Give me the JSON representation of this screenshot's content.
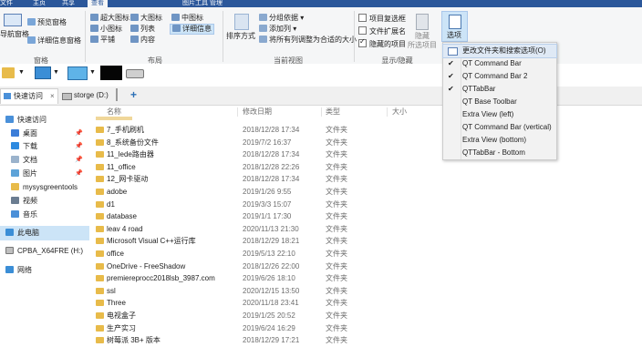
{
  "ribbon_tabs": [
    "文件",
    "主页",
    "共享",
    "查看",
    "图片工具 管理"
  ],
  "ribbon": {
    "pane_group": {
      "nav_pane": "导航窗格",
      "preview_pane": "预览窗格",
      "details_pane": "详细信息窗格",
      "label": "窗格"
    },
    "layout_group": {
      "extra_large": "超大图标",
      "large": "大图标",
      "medium": "中图标",
      "small": "小图标",
      "list": "列表",
      "details": "详细信息",
      "tiles": "平铺",
      "content": "内容",
      "label": "布局"
    },
    "current_view_group": {
      "sort_by": "排序方式",
      "group_by": "分组依据",
      "add_column": "添加列",
      "size_all_columns": "将所有列调整为合适的大小",
      "label": "当前视图"
    },
    "show_hide_group": {
      "item_checkboxes": "项目复选框",
      "file_extensions": "文件扩展名",
      "hidden_items": "隐藏的项目",
      "hide_selected": "隐藏",
      "hide_selected_2": "所选项目",
      "label": "显示/隐藏",
      "hidden_items_checked": true
    },
    "options_button": "选项"
  },
  "explorer_tabs": [
    {
      "label": "快速访问"
    },
    {
      "label": "storge (D:)"
    }
  ],
  "new_tab_button": "+",
  "close_tab_glyph": "×",
  "nav": {
    "quick_access": "快速访问",
    "items": [
      {
        "label": "桌面",
        "pinned": true
      },
      {
        "label": "下载",
        "pinned": true
      },
      {
        "label": "文档",
        "pinned": true
      },
      {
        "label": "图片",
        "pinned": true
      },
      {
        "label": "mysysgreentools"
      },
      {
        "label": "视频"
      },
      {
        "label": "音乐"
      }
    ],
    "this_pc": "此电脑",
    "drive": "CPBA_X64FRE (H:)",
    "network": "网络"
  },
  "columns": {
    "name": "名称",
    "date": "修改日期",
    "type": "类型",
    "size": "大小"
  },
  "files": [
    {
      "name": "7_手机刷机",
      "date": "2018/12/28 17:34",
      "type": "文件夹"
    },
    {
      "name": "8_系统备份文件",
      "date": "2019/7/2 16:37",
      "type": "文件夹"
    },
    {
      "name": "11_lede路由器",
      "date": "2018/12/28 17:34",
      "type": "文件夹"
    },
    {
      "name": "11_office",
      "date": "2018/12/28 22:26",
      "type": "文件夹"
    },
    {
      "name": "12_网卡驱动",
      "date": "2018/12/28 17:34",
      "type": "文件夹"
    },
    {
      "name": "adobe",
      "date": "2019/1/26 9:55",
      "type": "文件夹"
    },
    {
      "name": "d1",
      "date": "2019/3/3 15:07",
      "type": "文件夹"
    },
    {
      "name": "database",
      "date": "2019/1/1 17:30",
      "type": "文件夹"
    },
    {
      "name": "leav 4 road",
      "date": "2020/11/13 21:30",
      "type": "文件夹"
    },
    {
      "name": "Microsoft Visual C++运行库",
      "date": "2018/12/29 18:21",
      "type": "文件夹"
    },
    {
      "name": "office",
      "date": "2019/5/13 22:10",
      "type": "文件夹"
    },
    {
      "name": "OneDrive - FreeShadow",
      "date": "2018/12/26 22:00",
      "type": "文件夹"
    },
    {
      "name": "premiereprocc2018lsb_3987.com",
      "date": "2019/6/26 18:10",
      "type": "文件夹"
    },
    {
      "name": "ssl",
      "date": "2020/12/15 13:50",
      "type": "文件夹"
    },
    {
      "name": "Three",
      "date": "2020/11/18 23:41",
      "type": "文件夹"
    },
    {
      "name": "电视盒子",
      "date": "2019/1/25 20:52",
      "type": "文件夹"
    },
    {
      "name": "生产实习",
      "date": "2019/6/24 16:29",
      "type": "文件夹"
    },
    {
      "name": "树莓派 3B+ 版本",
      "date": "2018/12/29 17:21",
      "type": "文件夹"
    }
  ],
  "options_menu": {
    "items": [
      {
        "label": "更改文件夹和搜索选项(O)",
        "checked": false
      },
      {
        "label": "QT Command Bar",
        "checked": true
      },
      {
        "label": "QT Command Bar 2",
        "checked": true
      },
      {
        "label": "QTTabBar",
        "checked": true
      },
      {
        "label": "QT Base Toolbar",
        "checked": false
      },
      {
        "label": "Extra View (left)",
        "checked": false
      },
      {
        "label": "QT Command Bar (vertical)",
        "checked": false
      },
      {
        "label": "Extra View (bottom)",
        "checked": false
      },
      {
        "label": "QTTabBar - Bottom",
        "checked": false
      }
    ]
  },
  "colors": {
    "accent": "#2b579a",
    "folder": "#e8bb4a",
    "selected": "#cce4f7"
  }
}
